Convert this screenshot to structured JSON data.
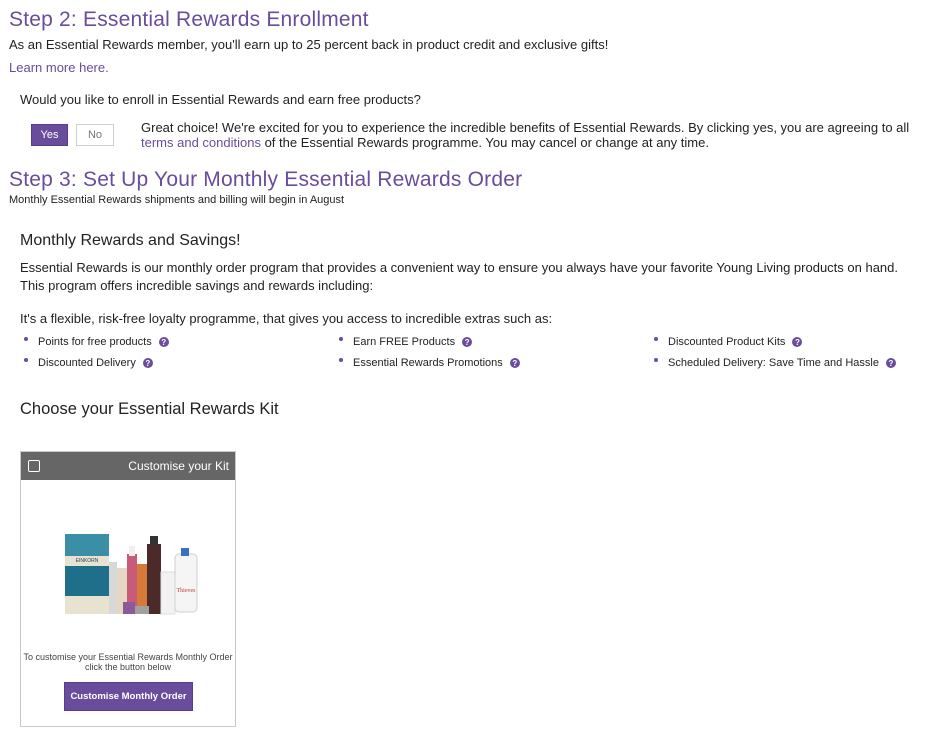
{
  "step2": {
    "title": "Step 2: Essential Rewards Enrollment",
    "intro": "As an Essential Rewards member, you'll earn up to 25 percent back in product credit and exclusive gifts!",
    "learn_more": "Learn more here.",
    "question": "Would you like to enroll in Essential Rewards and earn free products?",
    "yes_label": "Yes",
    "no_label": "No",
    "benefit_before_link": "Great choice! We're excited for you to experience the incredible benefits of Essential Rewards. By clicking yes, you are agreeing to all ",
    "terms_link": "terms and conditions",
    "benefit_after_link": " of the Essential Rewards programme. You may cancel or change at any time."
  },
  "step3": {
    "title": "Step 3: Set Up Your Monthly Essential Rewards Order",
    "subtitle": "Monthly Essential Rewards shipments and billing will begin in August",
    "savings_heading": "Monthly Rewards and Savings!",
    "savings_text": "Essential Rewards is our monthly order program that provides a convenient way to ensure you always have your favorite Young Living products on hand.  This program offers incredible savings and rewards including:",
    "flex_text": "It's a flexible, risk-free loyalty programme, that gives you access to incredible extras such as:",
    "benefits": [
      "Points for free products",
      "Earn FREE Products",
      "Discounted Product Kits",
      "Discounted Delivery",
      "Essential Rewards Promotions",
      "Scheduled Delivery: Save Time and Hassle"
    ],
    "kit_heading": "Choose your Essential Rewards Kit"
  },
  "kit_card": {
    "title": "Customise your Kit",
    "description": "To customise your Essential Rewards Monthly Order click the button below",
    "button_label": "Customise Monthly Order",
    "image_labels": {
      "box": "EINKORN",
      "bottle": "Thieves"
    }
  },
  "colors": {
    "accent": "#6a4c9c",
    "card_header": "#666666"
  },
  "icons": {
    "help": "question-circle-icon",
    "checkbox": "checkbox-icon"
  }
}
